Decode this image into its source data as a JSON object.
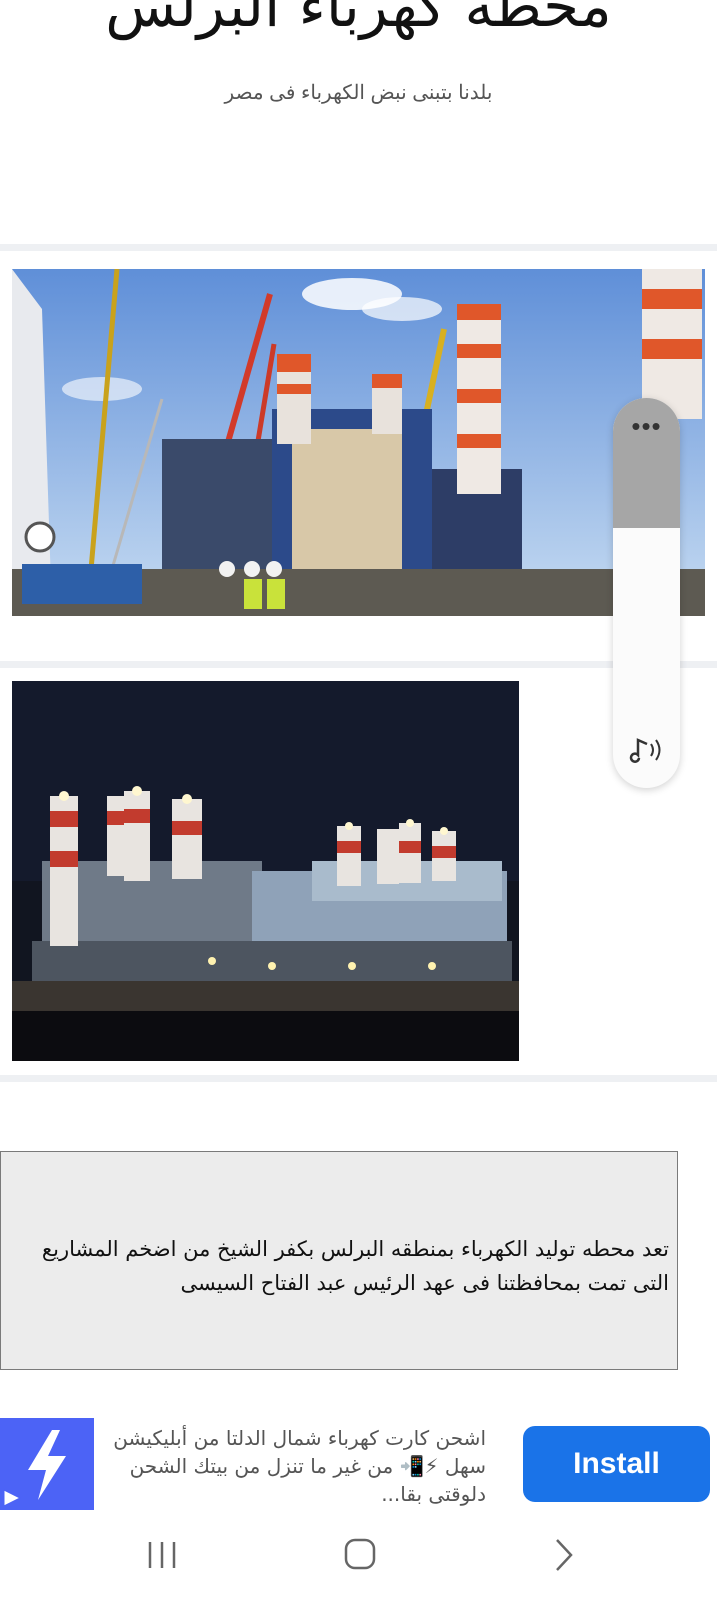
{
  "header": {
    "title": "محطه كهرباء البرلس",
    "subtitle": "بلدنا بتبنى نبض الكهرباء فى مصر"
  },
  "images": [
    {
      "name": "construction-photo"
    },
    {
      "name": "night-plant-photo"
    }
  ],
  "floating_panel": {
    "menu_icon": "more-dots-icon",
    "audio_icon": "audio-speaker-icon"
  },
  "article": {
    "text": "تعد محطه توليد الكهرباء بمنطقه البرلس بكفر الشيخ من اضخم المشاريع التى تمت بمحافظتنا فى عهد الرئيس عبد الفتاح السيسى"
  },
  "ad": {
    "text": "اشحن كارت كهرباء شمال الدلتا من أبليكيشن سهل ⚡📲 من غير ما تنزل من بيتك الشحن دلوقتى بقا...",
    "button_label": "Install",
    "icon": "lightning-bolt-icon",
    "badge_icon": "ad-choices-icon"
  },
  "navigation": {
    "recents_icon": "recent-apps-icon",
    "home_icon": "home-icon",
    "back_icon": "back-chevron-icon"
  },
  "colors": {
    "separator": "#eef0f3",
    "text_box": "#ececec",
    "install": "#1a73e8",
    "ad_icon_bg": "#4c63f6"
  }
}
